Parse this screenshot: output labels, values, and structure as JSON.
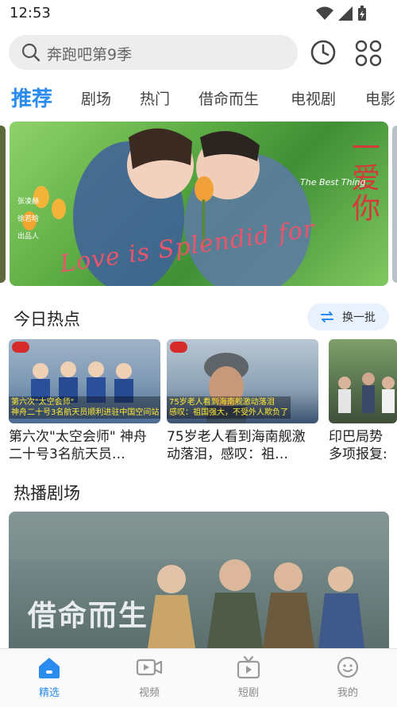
{
  "status_bar": {
    "time": "12:53"
  },
  "search": {
    "placeholder": "奔跑吧第9季"
  },
  "tabs": [
    {
      "label": "推荐",
      "active": true
    },
    {
      "label": "剧场"
    },
    {
      "label": "热门"
    },
    {
      "label": "借命而生"
    },
    {
      "label": "电视剧"
    },
    {
      "label": "电影"
    }
  ],
  "banner": {
    "title": "一爱你",
    "subtitle": "The Best Thing",
    "script": "Love is Splendid for",
    "cast": [
      "张凌赫",
      "徐若晗",
      "出品人"
    ]
  },
  "hot_today": {
    "title": "今日热点",
    "refresh_label": "换一批",
    "items": [
      {
        "overlay_1": "第六次\"太空会师\"",
        "overlay_2": "神舟二十号3名航天员顺利进驻中国空间站",
        "title": "第六次\"太空会师\" 神舟二十号3名航天员…"
      },
      {
        "overlay_1": "75岁老人看到海南舰激动落泪",
        "overlay_2": "感叹：祖国强大，不受外人欺负了",
        "title": "75岁老人看到海南舰激动落泪，感叹：祖…"
      },
      {
        "overlay_1": "",
        "overlay_2": "",
        "title": "印巴局势 多项报复:"
      }
    ]
  },
  "hot_drama": {
    "title": "热播剧场",
    "poster_title": "借命而生"
  },
  "bottom_nav": [
    {
      "label": "精选",
      "icon": "home-icon",
      "active": true
    },
    {
      "label": "视频",
      "icon": "video-icon"
    },
    {
      "label": "短剧",
      "icon": "tv-icon"
    },
    {
      "label": "我的",
      "icon": "smile-icon"
    }
  ],
  "colors": {
    "accent": "#2b8cf0",
    "banner_title": "#d43a3a"
  }
}
